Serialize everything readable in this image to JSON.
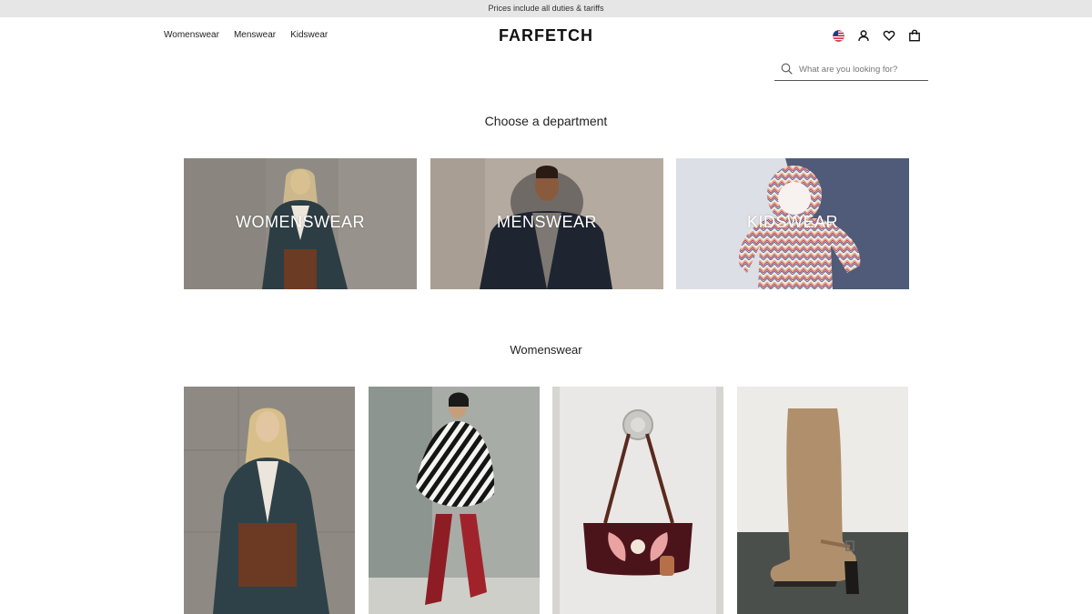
{
  "banner": {
    "text": "Prices include all duties & tariffs"
  },
  "nav": {
    "items": [
      {
        "label": "Womenswear"
      },
      {
        "label": "Menswear"
      },
      {
        "label": "Kidswear"
      }
    ]
  },
  "brand": {
    "logo_text": "FARFETCH"
  },
  "header_icons": [
    "us-flag-icon",
    "account-icon",
    "wishlist-heart-icon",
    "shopping-bag-icon"
  ],
  "search": {
    "placeholder": "What are you looking for?",
    "value": ""
  },
  "departments": {
    "title": "Choose a department",
    "cards": [
      {
        "label": "WOMENSWEAR"
      },
      {
        "label": "MENSWEAR"
      },
      {
        "label": "KIDSWEAR"
      }
    ]
  },
  "womenswear_section": {
    "title": "Womenswear",
    "products": [
      {
        "image": "woman-in-coat-photo"
      },
      {
        "image": "zebra-print-outfit-photo"
      },
      {
        "image": "embroidered-handbag-photo"
      },
      {
        "image": "suede-knee-boot-photo"
      }
    ]
  },
  "colors": {
    "banner_bg": "#e6e6e6",
    "text": "#222222",
    "background": "#ffffff"
  }
}
